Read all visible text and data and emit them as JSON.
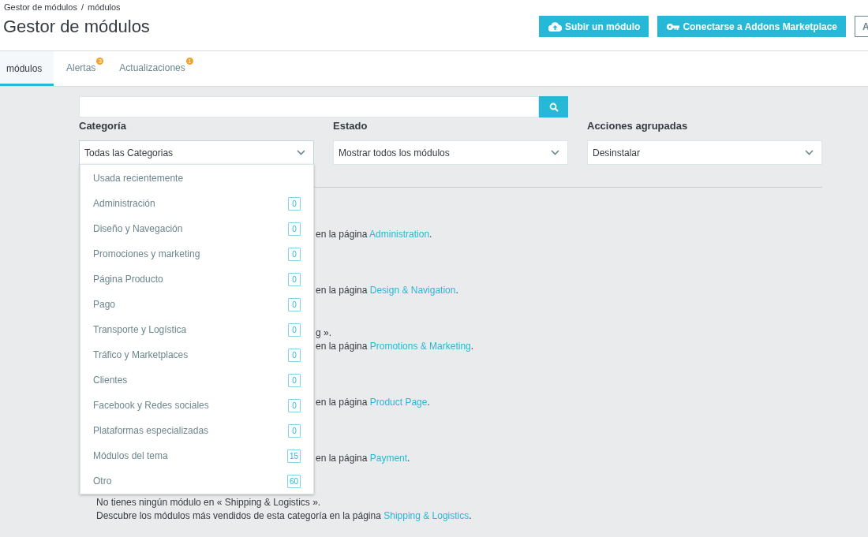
{
  "breadcrumb": [
    {
      "label": "Gestor de módulos"
    },
    {
      "label": "módulos"
    }
  ],
  "breadcrumb_separator": "/",
  "title": "Gestor de módulos",
  "toolbar_buttons": [
    {
      "label": "Subir un módulo",
      "kind": "upload"
    },
    {
      "label": "Conectarse a Addons Marketplace",
      "kind": "key"
    },
    {
      "label": "A",
      "kind": "outline"
    }
  ],
  "tabs": [
    {
      "label": "módulos",
      "selected": true
    },
    {
      "label": "Alertas",
      "selected": false,
      "badge": "3"
    },
    {
      "label": "Actualizaciones",
      "selected": false,
      "badge": "1"
    }
  ],
  "filters": [
    {
      "label": "Categoría",
      "value": "Todas las Categorias",
      "expanded": true
    },
    {
      "label": "Estado",
      "value": "Mostrar todos los módulos",
      "expanded": false
    },
    {
      "label": "Acciones agrupadas",
      "value": "Desinstalar",
      "expanded": false
    }
  ],
  "category_menu": [
    {
      "label": "Usada recientemente"
    },
    {
      "label": "Administración",
      "count": "0"
    },
    {
      "label": "Diseño y Navegación",
      "count": "0"
    },
    {
      "label": "Promociones y marketing",
      "count": "0"
    },
    {
      "label": "Página Producto",
      "count": "0"
    },
    {
      "label": "Pago",
      "count": "0"
    },
    {
      "label": "Transporte y Logística",
      "count": "0"
    },
    {
      "label": "Tráfico y Marketplaces",
      "count": "0"
    },
    {
      "label": "Clientes",
      "count": "0"
    },
    {
      "label": "Facebook y Redes sociales",
      "count": "0"
    },
    {
      "label": "Plataformas especializadas",
      "count": "0"
    },
    {
      "label": "Módulos del tema",
      "count": "15"
    },
    {
      "label": "Otro",
      "count": "60"
    }
  ],
  "notes": [
    {
      "kind": "covered",
      "lines": [
        {
          "text": "en la página ",
          "link": "Administration",
          "suffix": "."
        }
      ]
    },
    {
      "kind": "covered",
      "lines": [
        {
          "text": "en la página ",
          "link": "Design & Navigation",
          "suffix": "."
        }
      ]
    },
    {
      "kind": "covered",
      "lines": [
        {
          "text": "g »."
        },
        {
          "text": "en la página ",
          "link": "Promotions & Marketing",
          "suffix": "."
        }
      ]
    },
    {
      "kind": "covered",
      "lines": [
        {
          "text": "en la página ",
          "link": "Product Page",
          "suffix": "."
        }
      ]
    },
    {
      "kind": "covered",
      "lines": [
        {
          "text": "en la página ",
          "link": "Payment",
          "suffix": "."
        }
      ]
    },
    {
      "kind": "full",
      "lines": [
        {
          "text": "No tienes ningún módulo en « Shipping & Logistics »."
        },
        {
          "text": "Descubre los módulos más vendidos de esta categoría en la página ",
          "link": "Shipping & Logistics",
          "suffix": "."
        }
      ]
    }
  ]
}
